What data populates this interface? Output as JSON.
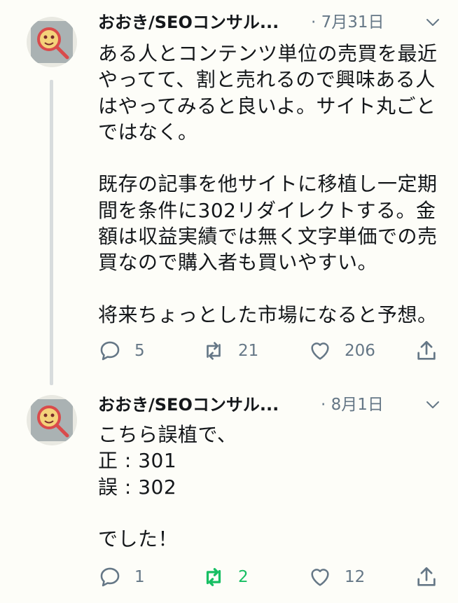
{
  "tweets": [
    {
      "name": "おおき/SEOコンサル...",
      "date": "· 7月31日",
      "text": "ある人とコンテンツ単位の売買を最近\nやってて、割と売れるので興味ある人\nはやってみると良いよ。サイト丸ごと\nではなく。\n\n既存の記事を他サイトに移植し一定期\n間を条件に302リダイレクトする。金\n額は収益実績では無く文字単価での売\n買なので購入者も買いやすい。\n\n将来ちょっとした市場になると予想。",
      "replies": "5",
      "retweets": "21",
      "likes": "206"
    },
    {
      "name": "おおき/SEOコンサル...",
      "date": "· 8月1日",
      "text": "こちら誤植で、\n正 : 301\n誤 : 302\n\nでした！",
      "replies": "1",
      "retweets": "2",
      "likes": "12"
    }
  ],
  "colors": {
    "muted": "#657786",
    "retweet_active": "#17bf63",
    "avatar_accent": "#d94b4b"
  }
}
